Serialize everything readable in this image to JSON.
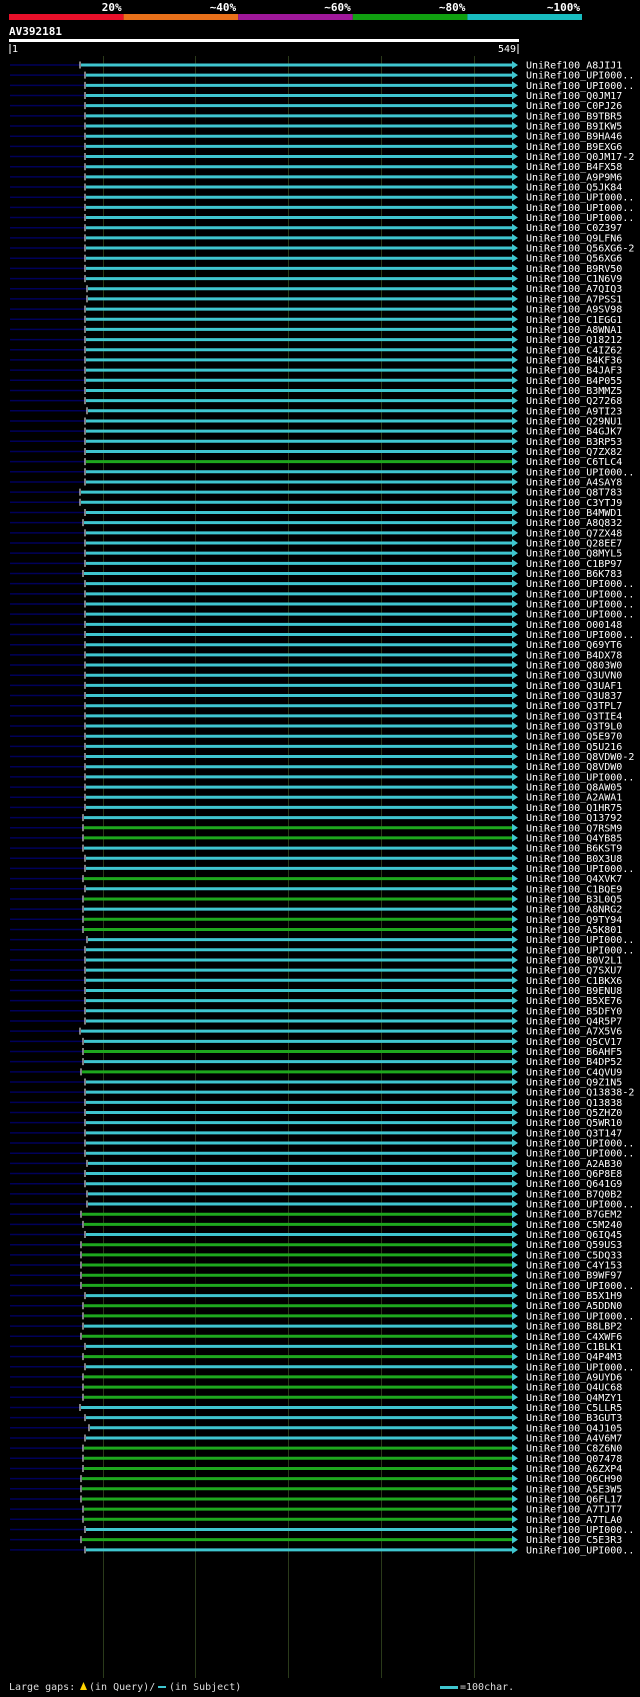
{
  "colors": {
    "background": "#000000",
    "axis": "#ffffff",
    "gridline": "#2a3a1a",
    "rowline": "#00005a",
    "cyan": "#3fc6cf",
    "green": "#1ea81e",
    "scale": [
      "#e8102a",
      "#e8701a",
      "#a0189a",
      "#10a010",
      "#18bcc0"
    ]
  },
  "scale_labels": [
    "20%",
    "~40%",
    "~60%",
    "~80%",
    "~100%"
  ],
  "query": {
    "name": "AV392181",
    "start": "1",
    "end": "549",
    "length": 549
  },
  "legend": {
    "gaps_label": "Large gaps:",
    "query_gap_text": "(in Query)/",
    "subject_gap_text": "(in Subject)",
    "scale_text": "=100char."
  },
  "hits": [
    {
      "id": "UniRef100_A8JIJ1",
      "start": 76,
      "color": "cyan"
    },
    {
      "id": "UniRef100_UPI000..",
      "start": 82,
      "color": "cyan"
    },
    {
      "id": "UniRef100_UPI000..",
      "start": 82,
      "color": "cyan"
    },
    {
      "id": "UniRef100_Q0JM17",
      "start": 82,
      "color": "cyan"
    },
    {
      "id": "UniRef100_C0PJ26",
      "start": 82,
      "color": "cyan"
    },
    {
      "id": "UniRef100_B9TBR5",
      "start": 82,
      "color": "cyan"
    },
    {
      "id": "UniRef100_B9IKW5",
      "start": 82,
      "color": "cyan"
    },
    {
      "id": "UniRef100_B9HA46",
      "start": 82,
      "color": "cyan"
    },
    {
      "id": "UniRef100_B9EXG6",
      "start": 82,
      "color": "cyan"
    },
    {
      "id": "UniRef100_Q0JM17-2",
      "start": 82,
      "color": "cyan"
    },
    {
      "id": "UniRef100_B4FX58",
      "start": 82,
      "color": "cyan"
    },
    {
      "id": "UniRef100_A9P9M6",
      "start": 82,
      "color": "cyan"
    },
    {
      "id": "UniRef100_Q5JK84",
      "start": 82,
      "color": "cyan"
    },
    {
      "id": "UniRef100_UPI000..",
      "start": 82,
      "color": "cyan"
    },
    {
      "id": "UniRef100_UPI000..",
      "start": 82,
      "color": "cyan"
    },
    {
      "id": "UniRef100_UPI000..",
      "start": 82,
      "color": "cyan"
    },
    {
      "id": "UniRef100_C0Z397",
      "start": 82,
      "color": "cyan"
    },
    {
      "id": "UniRef100_Q9LFN6",
      "start": 82,
      "color": "cyan"
    },
    {
      "id": "UniRef100_Q56XG6-2",
      "start": 82,
      "color": "cyan"
    },
    {
      "id": "UniRef100_Q56XG6",
      "start": 82,
      "color": "cyan"
    },
    {
      "id": "UniRef100_B9RV50",
      "start": 82,
      "color": "cyan"
    },
    {
      "id": "UniRef100_C1N6V9",
      "start": 82,
      "color": "cyan"
    },
    {
      "id": "UniRef100_A7QIQ3",
      "start": 84,
      "color": "cyan"
    },
    {
      "id": "UniRef100_A7PSS1",
      "start": 84,
      "color": "cyan"
    },
    {
      "id": "UniRef100_A9SV98",
      "start": 82,
      "color": "cyan"
    },
    {
      "id": "UniRef100_C1EGG1",
      "start": 82,
      "color": "cyan"
    },
    {
      "id": "UniRef100_A8WNA1",
      "start": 82,
      "color": "cyan"
    },
    {
      "id": "UniRef100_Q18212",
      "start": 82,
      "color": "cyan"
    },
    {
      "id": "UniRef100_C4IZ62",
      "start": 82,
      "color": "cyan"
    },
    {
      "id": "UniRef100_B4KF36",
      "start": 82,
      "color": "cyan"
    },
    {
      "id": "UniRef100_B4JAF3",
      "start": 82,
      "color": "cyan"
    },
    {
      "id": "UniRef100_B4P055",
      "start": 82,
      "color": "cyan"
    },
    {
      "id": "UniRef100_B3MMZ5",
      "start": 82,
      "color": "cyan"
    },
    {
      "id": "UniRef100_Q27268",
      "start": 82,
      "color": "cyan"
    },
    {
      "id": "UniRef100_A9TI23",
      "start": 84,
      "color": "cyan"
    },
    {
      "id": "UniRef100_Q29NU1",
      "start": 82,
      "color": "cyan"
    },
    {
      "id": "UniRef100_B4GJK7",
      "start": 82,
      "color": "cyan"
    },
    {
      "id": "UniRef100_B3RP53",
      "start": 82,
      "color": "cyan"
    },
    {
      "id": "UniRef100_Q7ZX82",
      "start": 82,
      "color": "cyan"
    },
    {
      "id": "UniRef100_C6TLC4",
      "start": 82,
      "color": "green"
    },
    {
      "id": "UniRef100_UPI000..",
      "start": 82,
      "color": "cyan"
    },
    {
      "id": "UniRef100_A4SAY8",
      "start": 82,
      "color": "cyan"
    },
    {
      "id": "UniRef100_Q8T783",
      "start": 76,
      "color": "cyan"
    },
    {
      "id": "UniRef100_C3YTJ9",
      "start": 76,
      "color": "cyan"
    },
    {
      "id": "UniRef100_B4MWD1",
      "start": 82,
      "color": "cyan"
    },
    {
      "id": "UniRef100_A8Q832",
      "start": 80,
      "color": "cyan"
    },
    {
      "id": "UniRef100_Q7ZX48",
      "start": 82,
      "color": "cyan"
    },
    {
      "id": "UniRef100_Q28EE7",
      "start": 82,
      "color": "cyan"
    },
    {
      "id": "UniRef100_Q8MYL5",
      "start": 82,
      "color": "cyan"
    },
    {
      "id": "UniRef100_C1BP97",
      "start": 82,
      "color": "cyan"
    },
    {
      "id": "UniRef100_B6K783",
      "start": 80,
      "color": "cyan"
    },
    {
      "id": "UniRef100_UPI000..",
      "start": 82,
      "color": "cyan"
    },
    {
      "id": "UniRef100_UPI000..",
      "start": 82,
      "color": "cyan"
    },
    {
      "id": "UniRef100_UPI000..",
      "start": 82,
      "color": "cyan"
    },
    {
      "id": "UniRef100_UPI000..",
      "start": 82,
      "color": "cyan"
    },
    {
      "id": "UniRef100_O00148",
      "start": 82,
      "color": "cyan"
    },
    {
      "id": "UniRef100_UPI000..",
      "start": 82,
      "color": "cyan"
    },
    {
      "id": "UniRef100_Q69YT6",
      "start": 82,
      "color": "cyan"
    },
    {
      "id": "UniRef100_B4DX78",
      "start": 82,
      "color": "cyan"
    },
    {
      "id": "UniRef100_Q803W0",
      "start": 82,
      "color": "cyan"
    },
    {
      "id": "UniRef100_Q3UVN0",
      "start": 82,
      "color": "cyan"
    },
    {
      "id": "UniRef100_Q3UAF1",
      "start": 82,
      "color": "cyan"
    },
    {
      "id": "UniRef100_Q3U837",
      "start": 82,
      "color": "cyan"
    },
    {
      "id": "UniRef100_Q3TPL7",
      "start": 82,
      "color": "cyan"
    },
    {
      "id": "UniRef100_Q3TIE4",
      "start": 82,
      "color": "cyan"
    },
    {
      "id": "UniRef100_Q3T9L0",
      "start": 82,
      "color": "cyan"
    },
    {
      "id": "UniRef100_Q5E970",
      "start": 82,
      "color": "cyan"
    },
    {
      "id": "UniRef100_Q5U216",
      "start": 82,
      "color": "cyan"
    },
    {
      "id": "UniRef100_Q8VDW0-2",
      "start": 82,
      "color": "cyan"
    },
    {
      "id": "UniRef100_Q8VDW0",
      "start": 82,
      "color": "cyan"
    },
    {
      "id": "UniRef100_UPI000..",
      "start": 82,
      "color": "cyan"
    },
    {
      "id": "UniRef100_Q8AW05",
      "start": 82,
      "color": "cyan"
    },
    {
      "id": "UniRef100_A2AWA1",
      "start": 82,
      "color": "cyan"
    },
    {
      "id": "UniRef100_Q1HR75",
      "start": 82,
      "color": "cyan"
    },
    {
      "id": "UniRef100_Q13792",
      "start": 80,
      "color": "cyan"
    },
    {
      "id": "UniRef100_Q7RSM9",
      "start": 80,
      "color": "green"
    },
    {
      "id": "UniRef100_Q4YB85",
      "start": 80,
      "color": "green"
    },
    {
      "id": "UniRef100_B6KST9",
      "start": 80,
      "color": "cyan"
    },
    {
      "id": "UniRef100_B0X3U8",
      "start": 82,
      "color": "cyan"
    },
    {
      "id": "UniRef100_UPI000..",
      "start": 82,
      "color": "cyan"
    },
    {
      "id": "UniRef100_Q4XVK7",
      "start": 80,
      "color": "green"
    },
    {
      "id": "UniRef100_C1BQE9",
      "start": 82,
      "color": "cyan"
    },
    {
      "id": "UniRef100_B3L0Q5",
      "start": 80,
      "color": "green"
    },
    {
      "id": "UniRef100_A8NRG2",
      "start": 80,
      "color": "cyan"
    },
    {
      "id": "UniRef100_Q9TY94",
      "start": 80,
      "color": "green"
    },
    {
      "id": "UniRef100_A5K801",
      "start": 80,
      "color": "green"
    },
    {
      "id": "UniRef100_UPI000..",
      "start": 84,
      "color": "cyan"
    },
    {
      "id": "UniRef100_UPI000..",
      "start": 82,
      "color": "cyan"
    },
    {
      "id": "UniRef100_B0V2L1",
      "start": 82,
      "color": "cyan"
    },
    {
      "id": "UniRef100_Q7SXU7",
      "start": 82,
      "color": "cyan"
    },
    {
      "id": "UniRef100_C1BKX6",
      "start": 82,
      "color": "cyan"
    },
    {
      "id": "UniRef100_B9ENU8",
      "start": 82,
      "color": "cyan"
    },
    {
      "id": "UniRef100_B5XE76",
      "start": 82,
      "color": "cyan"
    },
    {
      "id": "UniRef100_B5DFY0",
      "start": 82,
      "color": "cyan"
    },
    {
      "id": "UniRef100_Q4R5P7",
      "start": 82,
      "color": "cyan"
    },
    {
      "id": "UniRef100_A7X5V6",
      "start": 76,
      "color": "cyan"
    },
    {
      "id": "UniRef100_Q5CV17",
      "start": 80,
      "color": "cyan"
    },
    {
      "id": "UniRef100_B6AHF5",
      "start": 80,
      "color": "green"
    },
    {
      "id": "UniRef100_B4DP52",
      "start": 80,
      "color": "cyan"
    },
    {
      "id": "UniRef100_C4QVU9",
      "start": 78,
      "color": "green"
    },
    {
      "id": "UniRef100_Q9Z1N5",
      "start": 82,
      "color": "cyan"
    },
    {
      "id": "UniRef100_Q13838-2",
      "start": 82,
      "color": "cyan"
    },
    {
      "id": "UniRef100_Q13838",
      "start": 82,
      "color": "cyan"
    },
    {
      "id": "UniRef100_Q5ZHZ0",
      "start": 82,
      "color": "cyan"
    },
    {
      "id": "UniRef100_Q5WR10",
      "start": 82,
      "color": "cyan"
    },
    {
      "id": "UniRef100_Q3T147",
      "start": 82,
      "color": "cyan"
    },
    {
      "id": "UniRef100_UPI000..",
      "start": 82,
      "color": "cyan"
    },
    {
      "id": "UniRef100_UPI000..",
      "start": 82,
      "color": "cyan"
    },
    {
      "id": "UniRef100_A2AB30",
      "start": 84,
      "color": "cyan"
    },
    {
      "id": "UniRef100_Q6P8E8",
      "start": 82,
      "color": "cyan"
    },
    {
      "id": "UniRef100_Q641G9",
      "start": 82,
      "color": "cyan"
    },
    {
      "id": "UniRef100_B7Q0B2",
      "start": 84,
      "color": "cyan"
    },
    {
      "id": "UniRef100_UPI000..",
      "start": 84,
      "color": "cyan"
    },
    {
      "id": "UniRef100_B7GEM2",
      "start": 78,
      "color": "green"
    },
    {
      "id": "UniRef100_C5M240",
      "start": 80,
      "color": "green"
    },
    {
      "id": "UniRef100_Q6IQ45",
      "start": 82,
      "color": "cyan"
    },
    {
      "id": "UniRef100_Q59US3",
      "start": 78,
      "color": "green"
    },
    {
      "id": "UniRef100_C5DQ33",
      "start": 78,
      "color": "green"
    },
    {
      "id": "UniRef100_C4Y153",
      "start": 78,
      "color": "green"
    },
    {
      "id": "UniRef100_B9WF97",
      "start": 78,
      "color": "green"
    },
    {
      "id": "UniRef100_UPI000..",
      "start": 78,
      "color": "green"
    },
    {
      "id": "UniRef100_B5X1H9",
      "start": 82,
      "color": "cyan"
    },
    {
      "id": "UniRef100_A5DDN0",
      "start": 80,
      "color": "green"
    },
    {
      "id": "UniRef100_UPI000..",
      "start": 80,
      "color": "green"
    },
    {
      "id": "UniRef100_B8LBP2",
      "start": 80,
      "color": "cyan"
    },
    {
      "id": "UniRef100_C4XWF6",
      "start": 78,
      "color": "green"
    },
    {
      "id": "UniRef100_C1BLK1",
      "start": 82,
      "color": "cyan"
    },
    {
      "id": "UniRef100_Q4P4M3",
      "start": 80,
      "color": "green"
    },
    {
      "id": "UniRef100_UPI000..",
      "start": 82,
      "color": "cyan"
    },
    {
      "id": "UniRef100_A9UYD6",
      "start": 80,
      "color": "green"
    },
    {
      "id": "UniRef100_Q4UC68",
      "start": 80,
      "color": "green"
    },
    {
      "id": "UniRef100_Q4MZY1",
      "start": 80,
      "color": "green"
    },
    {
      "id": "UniRef100_C5LLR5",
      "start": 76,
      "color": "cyan"
    },
    {
      "id": "UniRef100_B3GUT3",
      "start": 82,
      "color": "cyan"
    },
    {
      "id": "UniRef100_Q4J105",
      "start": 86,
      "color": "cyan"
    },
    {
      "id": "UniRef100_A4V6M7",
      "start": 82,
      "color": "cyan"
    },
    {
      "id": "UniRef100_C8Z6N0",
      "start": 80,
      "color": "green"
    },
    {
      "id": "UniRef100_Q07478",
      "start": 80,
      "color": "green"
    },
    {
      "id": "UniRef100_A6ZXP4",
      "start": 80,
      "color": "green"
    },
    {
      "id": "UniRef100_Q6CH90",
      "start": 78,
      "color": "green"
    },
    {
      "id": "UniRef100_A5E3W5",
      "start": 78,
      "color": "green"
    },
    {
      "id": "UniRef100_Q6FL17",
      "start": 78,
      "color": "green"
    },
    {
      "id": "UniRef100_A7TJT7",
      "start": 80,
      "color": "green"
    },
    {
      "id": "UniRef100_A7TLA0",
      "start": 80,
      "color": "green"
    },
    {
      "id": "UniRef100_UPI000..",
      "start": 82,
      "color": "cyan"
    },
    {
      "id": "UniRef100_C5E3R3",
      "start": 78,
      "color": "green"
    },
    {
      "id": "UniRef100_UPI000..",
      "start": 82,
      "color": "cyan"
    }
  ]
}
